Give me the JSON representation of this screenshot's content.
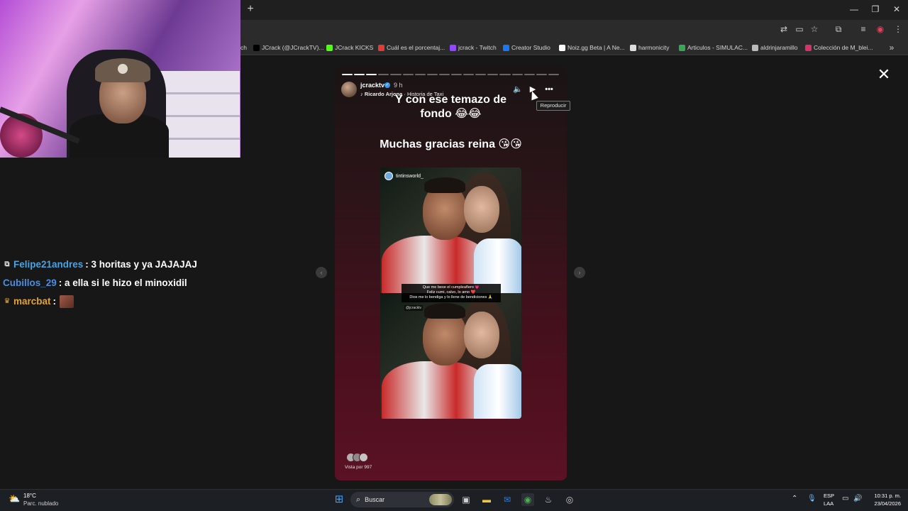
{
  "bookmarks": [
    {
      "label": "ch",
      "icon": "tab-fragment",
      "color": "#2b2b2b"
    },
    {
      "label": "JCrack (@JCrackTV)...",
      "icon": "x-icon",
      "color": "#000000"
    },
    {
      "label": "JCrack KICKS",
      "icon": "kick-icon",
      "color": "#53fc18"
    },
    {
      "label": "Cuál es el porcentaj...",
      "icon": "s-icon",
      "color": "#e03c31"
    },
    {
      "label": "jcrack - Twitch",
      "icon": "twitch-icon",
      "color": "#9146ff"
    },
    {
      "label": "Creator Studio",
      "icon": "facebook-icon",
      "color": "#1877f2"
    },
    {
      "label": "Noiz.gg Beta | A Ne...",
      "icon": "noiz-icon",
      "color": "#ffffff"
    },
    {
      "label": "harmonicity",
      "icon": "doc-icon",
      "color": "#dddddd"
    },
    {
      "label": "Articulos - SIMULAC...",
      "icon": "drive-icon",
      "color": "#34a853"
    },
    {
      "label": "aldrinjaramillo",
      "icon": "globe-icon",
      "color": "#bbbbbb"
    },
    {
      "label": "Colección de M_blei...",
      "icon": "collection-icon",
      "color": "#d6336c"
    }
  ],
  "story": {
    "username": "jcracktv",
    "time": "9 h",
    "music_artist": "Ricardo Arjona",
    "music_title": "· Historia de Taxi",
    "caption_line1": "Y con ese temazo de",
    "caption_line2": "fondo 😂😂",
    "caption_thanks": "Muchas gracias reina 😘😘",
    "tooltip": "Reproducir",
    "photo_tag": "tintinsworld_",
    "photo_caption_1": "Que me bese el cumpleañero 💗",
    "photo_caption_2": "Feliz cumi, calvo, lo amo ❤️",
    "photo_caption_3": "Dios me lo bendiga y lo llene de bendiciones 🙏",
    "photo_mention": "@jcracktv",
    "views": "Vista por 997",
    "progress_total": 18,
    "progress_done": 3
  },
  "chat": [
    {
      "user": "Felipe21andres",
      "text": ": 3 horitas y ya JAJAJAJ",
      "badge": "kick-badge"
    },
    {
      "user": "Cubillos_29",
      "text": ": a ella si le hizo el minoxidil",
      "badge": ""
    },
    {
      "user": "marcbat",
      "text": ":",
      "badge": "crown-badge"
    }
  ],
  "taskbar": {
    "temperature": "18°C",
    "condition": "Parc. nublado",
    "search_placeholder": "Buscar",
    "lang_line1": "ESP",
    "lang_line2": "LAA",
    "time": "10:31 p. m.",
    "date": "23/04/2026"
  }
}
